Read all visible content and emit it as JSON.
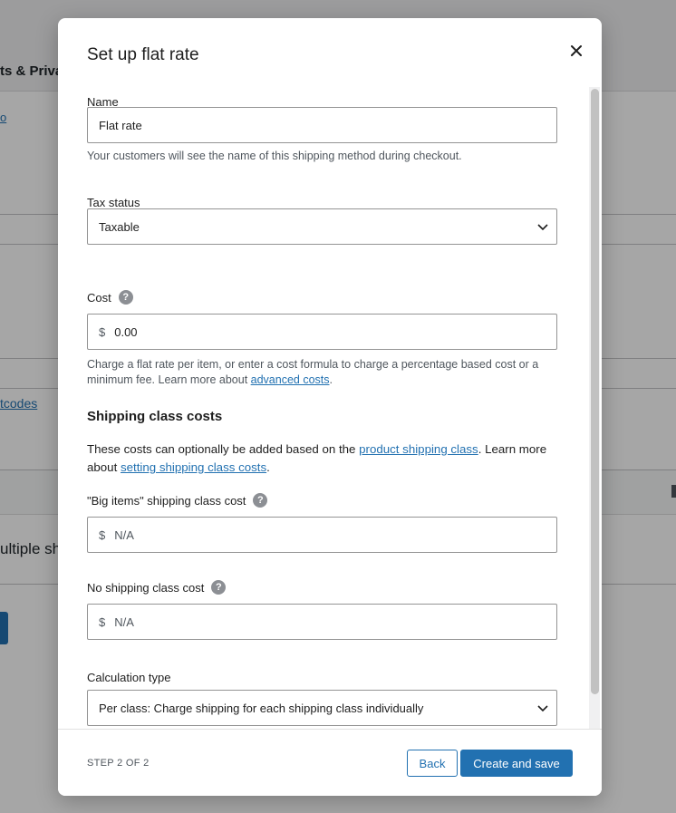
{
  "background": {
    "tab_text": "ts & Priva",
    "link_text": "o",
    "postcodes_link": "tcodes",
    "multiple_text": "ultiple sh"
  },
  "modal": {
    "title": "Set up flat rate",
    "close_icon": "close-icon",
    "name": {
      "label": "Name",
      "value": "Flat rate",
      "help": "Your customers will see the name of this shipping method during checkout."
    },
    "tax_status": {
      "label": "Tax status",
      "selected": "Taxable"
    },
    "cost": {
      "label": "Cost",
      "prefix": "$",
      "value": "0.00",
      "help_before": "Charge a flat rate per item, or enter a cost formula to charge a percentage based cost or a minimum fee. Learn more about ",
      "help_link": "advanced costs",
      "help_after": "."
    },
    "shipping_class_costs": {
      "title": "Shipping class costs",
      "intro_before": "These costs can optionally be added based on the ",
      "intro_link1": "product shipping class",
      "intro_middle": ". Learn more about ",
      "intro_link2": "setting shipping class costs",
      "intro_after": "."
    },
    "big_items_cost": {
      "label": "\"Big items\" shipping class cost",
      "prefix": "$",
      "placeholder": "N/A"
    },
    "no_class_cost": {
      "label": "No shipping class cost",
      "prefix": "$",
      "placeholder": "N/A"
    },
    "calculation_type": {
      "label": "Calculation type",
      "selected": "Per class: Charge shipping for each shipping class individually"
    },
    "help_icon_glyph": "?",
    "footer": {
      "step": "STEP 2 OF 2",
      "back_label": "Back",
      "submit_label": "Create and save"
    }
  },
  "colors": {
    "accent": "#2271b1",
    "overlay": "#000000",
    "help_text": "#50575e"
  }
}
